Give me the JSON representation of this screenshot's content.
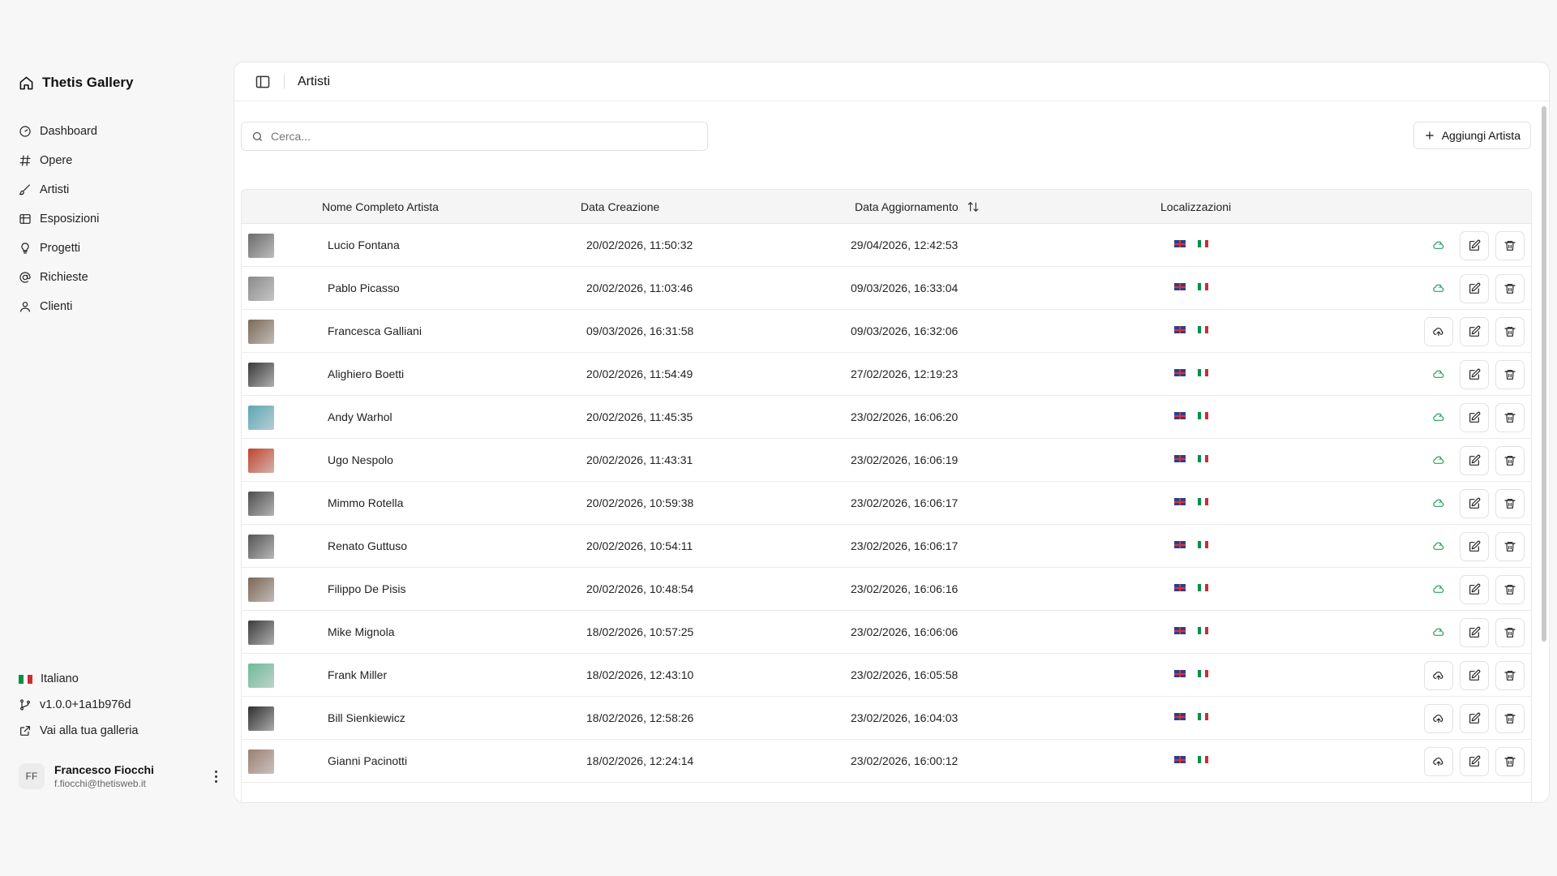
{
  "app": {
    "brand": "Thetis Gallery"
  },
  "sidebar": {
    "items": [
      {
        "label": "Dashboard",
        "icon": "dashboard-icon"
      },
      {
        "label": "Opere",
        "icon": "hash-icon"
      },
      {
        "label": "Artisti",
        "icon": "brush-icon"
      },
      {
        "label": "Esposizioni",
        "icon": "gallery-icon"
      },
      {
        "label": "Progetti",
        "icon": "lightbulb-icon"
      },
      {
        "label": "Richieste",
        "icon": "at-sign-icon"
      },
      {
        "label": "Clienti",
        "icon": "user-icon"
      }
    ],
    "language": "Italiano",
    "version": "v1.0.0+1a1b976d",
    "gallery_link": "Vai alla tua galleria",
    "user": {
      "initials": "FF",
      "name": "Francesco Fiocchi",
      "email": "f.fiocchi@thetisweb.it"
    }
  },
  "header": {
    "title": "Artisti"
  },
  "toolbar": {
    "search_placeholder": "Cerca...",
    "add_label": "Aggiungi Artista"
  },
  "table": {
    "columns": {
      "name": "Nome Completo Artista",
      "created": "Data Creazione",
      "updated": "Data Aggiornamento",
      "locales": "Localizzazioni"
    },
    "rows": [
      {
        "name": "Lucio Fontana",
        "created": "20/02/2026, 11:50:32",
        "updated": "29/04/2026, 12:42:53",
        "synced": true,
        "thumb": "#6b6b6b"
      },
      {
        "name": "Pablo Picasso",
        "created": "20/02/2026, 11:03:46",
        "updated": "09/03/2026, 16:33:04",
        "synced": true,
        "thumb": "#8a8a8a"
      },
      {
        "name": "Francesca Galliani",
        "created": "09/03/2026, 16:31:58",
        "updated": "09/03/2026, 16:32:06",
        "synced": false,
        "thumb": "#7a6a55"
      },
      {
        "name": "Alighiero Boetti",
        "created": "20/02/2026, 11:54:49",
        "updated": "27/02/2026, 12:19:23",
        "synced": true,
        "thumb": "#3a3a3a"
      },
      {
        "name": "Andy Warhol",
        "created": "20/02/2026, 11:45:35",
        "updated": "23/02/2026, 16:06:20",
        "synced": true,
        "thumb": "#5aa7b5"
      },
      {
        "name": "Ugo Nespolo",
        "created": "20/02/2026, 11:43:31",
        "updated": "23/02/2026, 16:06:19",
        "synced": true,
        "thumb": "#c0452e"
      },
      {
        "name": "Mimmo Rotella",
        "created": "20/02/2026, 10:59:38",
        "updated": "23/02/2026, 16:06:17",
        "synced": true,
        "thumb": "#4d4d4d"
      },
      {
        "name": "Renato Guttuso",
        "created": "20/02/2026, 10:54:11",
        "updated": "23/02/2026, 16:06:17",
        "synced": true,
        "thumb": "#555555"
      },
      {
        "name": "Filippo De Pisis",
        "created": "20/02/2026, 10:48:54",
        "updated": "23/02/2026, 16:06:16",
        "synced": true,
        "thumb": "#7b6655"
      },
      {
        "name": "Mike Mignola",
        "created": "18/02/2026, 10:57:25",
        "updated": "23/02/2026, 16:06:06",
        "synced": true,
        "thumb": "#3b3b3b"
      },
      {
        "name": "Frank Miller",
        "created": "18/02/2026, 12:43:10",
        "updated": "23/02/2026, 16:05:58",
        "synced": false,
        "thumb": "#6fb99a"
      },
      {
        "name": "Bill Sienkiewicz",
        "created": "18/02/2026, 12:58:26",
        "updated": "23/02/2026, 16:04:03",
        "synced": false,
        "thumb": "#2f2f2f"
      },
      {
        "name": "Gianni Pacinotti",
        "created": "18/02/2026, 12:24:14",
        "updated": "23/02/2026, 16:00:12",
        "synced": false,
        "thumb": "#9a7f72"
      }
    ]
  },
  "colors": {
    "accent_synced": "#22a35a",
    "flag_it": [
      "#009246",
      "#ffffff",
      "#ce2b37"
    ]
  }
}
